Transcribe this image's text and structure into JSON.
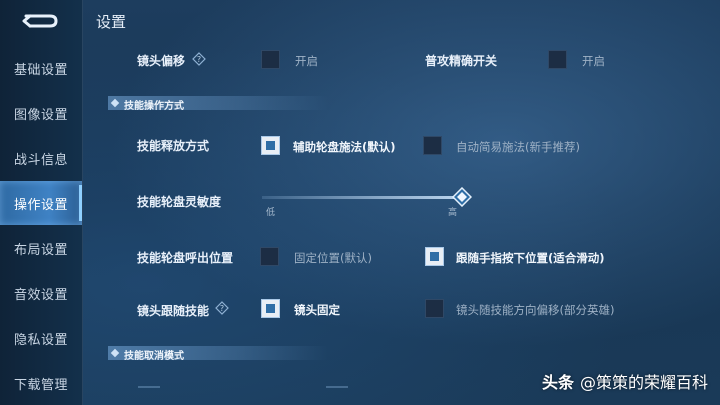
{
  "header": {
    "title": "设置"
  },
  "sidebar": {
    "items": [
      {
        "label": "基础设置"
      },
      {
        "label": "图像设置"
      },
      {
        "label": "战斗信息"
      },
      {
        "label": "操作设置",
        "active": true
      },
      {
        "label": "布局设置"
      },
      {
        "label": "音效设置"
      },
      {
        "label": "隐私设置"
      },
      {
        "label": "下载管理"
      }
    ]
  },
  "rows": {
    "camera_offset": {
      "label": "镜头偏移",
      "option": "开启",
      "checked": false
    },
    "attack_precision": {
      "label": "普攻精确开关",
      "option": "开启",
      "checked": false
    },
    "skill_cast": {
      "label": "技能释放方式",
      "option1": "辅助轮盘施法(默认)",
      "option1_checked": true,
      "option2": "自动简易施法(新手推荐)",
      "option2_checked": false
    },
    "wheel_sensitivity": {
      "label": "技能轮盘灵敏度",
      "low": "低",
      "high": "高",
      "value_fraction": 1.0
    },
    "wheel_position": {
      "label": "技能轮盘呼出位置",
      "option1": "固定位置(默认)",
      "option1_checked": false,
      "option2": "跟随手指按下位置(适合滑动)",
      "option2_checked": true
    },
    "camera_follow": {
      "label": "镜头跟随技能",
      "option1": "镜头固定",
      "option1_checked": true,
      "option2": "镜头随技能方向偏移(部分英雄)",
      "option2_checked": false
    }
  },
  "sections": {
    "skill_operation": "技能操作方式",
    "skill_cancel": "技能取消模式"
  },
  "watermark": {
    "site": "头条",
    "author": "@策策的荣耀百科"
  },
  "colors": {
    "accent": "#3f82c4",
    "check_fill": "#2f6ea6",
    "background": "#183654"
  }
}
